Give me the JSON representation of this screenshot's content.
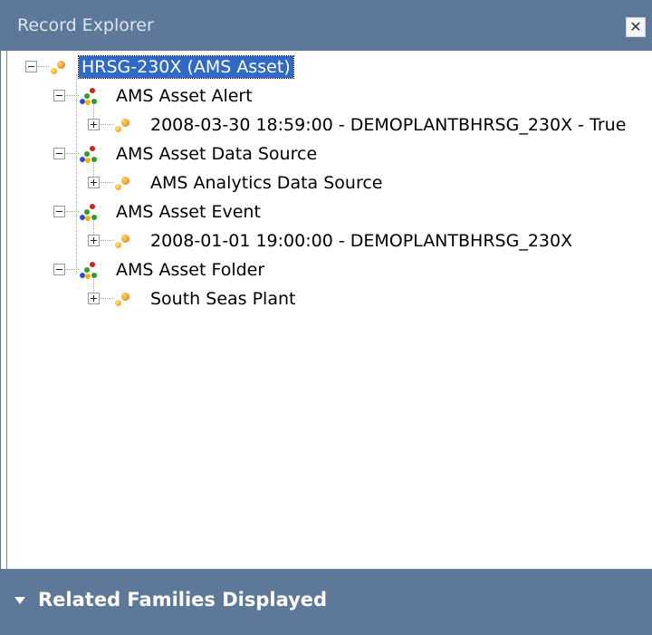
{
  "window": {
    "title": "Record Explorer",
    "close_label": "✕"
  },
  "tree": {
    "root": {
      "label": "HRSG-230X (AMS Asset)"
    },
    "families": [
      {
        "label": "AMS Asset Alert",
        "records": [
          "2008-03-30 18:59:00 - DEMOPLANTBHRSG_230X - True"
        ]
      },
      {
        "label": "AMS Asset Data Source",
        "records": [
          "AMS Analytics Data Source"
        ]
      },
      {
        "label": "AMS Asset Event",
        "records": [
          "2008-01-01 19:00:00 - DEMOPLANTBHRSG_230X"
        ]
      },
      {
        "label": "AMS Asset Folder",
        "records": [
          "South Seas Plant"
        ]
      }
    ]
  },
  "footer": {
    "label": "Related Families Displayed"
  },
  "icons": {
    "record": "record-icon",
    "family": "family-icon",
    "expand": "expand-icon",
    "collapse": "collapse-icon",
    "close": "close-icon",
    "dropdown": "triangle-down-icon"
  },
  "colors": {
    "header_bg": "#5d7898",
    "selection_bg": "#316ac5"
  }
}
